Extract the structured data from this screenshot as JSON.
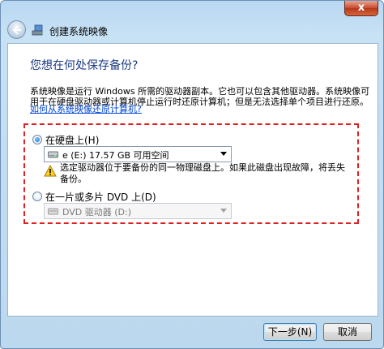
{
  "window": {
    "title": "创建系统映像",
    "close_label": "x"
  },
  "main": {
    "heading": "您想在何处保存备份?",
    "description": "系统映像是运行 Windows 所需的驱动器副本。它也可以包含其他驱动器。系统映像可用于在硬盘驱动器或计算机停止运行时还原计算机；但是无法选择单个项目进行还原。",
    "link": "如何从系统映像还原计算机?"
  },
  "options": {
    "hard_disk": {
      "label": "在硬盘上(H)",
      "selected": true,
      "dropdown_value": "e (E:)  17.57 GB 可用空间",
      "warning": "选定驱动器位于要备份的同一物理磁盘上。如果此磁盘出现故障，将丢失备份。"
    },
    "dvd": {
      "label": "在一片或多片 DVD 上(D)",
      "selected": false,
      "dropdown_value": "DVD 驱动器 (D:)"
    }
  },
  "footer": {
    "next_label": "下一步(N)",
    "cancel_label": "取消"
  },
  "colors": {
    "heading": "#1b3a86",
    "link": "#0046d5",
    "highlight": "#e02020",
    "window_frame": "#bcd8ee"
  },
  "icons": {
    "back": "back-arrow-icon",
    "app": "system-image-icon",
    "drive": "drive-icon",
    "warning": "warning-icon",
    "dropdown": "chevron-down-icon"
  }
}
